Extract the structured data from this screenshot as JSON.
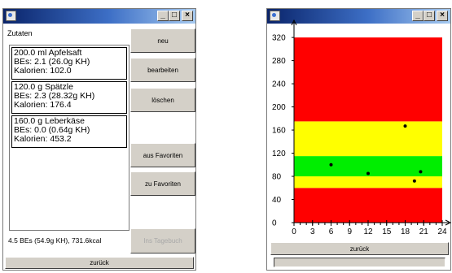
{
  "zutaten_window": {
    "title": "",
    "heading": "Zutaten",
    "items": [
      {
        "line1": "200.0 ml Apfelsaft",
        "line2": "BEs: 2.1  (26.0g KH)",
        "line3": "Kalorien: 102.0"
      },
      {
        "line1": "120.0 g Spätzle",
        "line2": "BEs: 2.3  (28.32g KH)",
        "line3": "Kalorien: 176.4"
      },
      {
        "line1": "160.0 g Leberkäse",
        "line2": "BEs: 0.0  (0.64g KH)",
        "line3": "Kalorien: 453.2"
      }
    ],
    "buttons": {
      "neu": "neu",
      "bearbeiten": "bearbeiten",
      "loeschen": "löschen",
      "aus_favoriten": "aus Favoriten",
      "zu_favoriten": "zu Favoriten",
      "ins_tagebuch": "Ins Tagebuch",
      "zurueck": "zurück"
    },
    "summary": "4.5 BEs (54.9g KH), 731.6kcal"
  },
  "chart_window": {
    "title": "",
    "zurueck": "zurück",
    "chart_data": {
      "type": "scatter",
      "x": [
        6,
        12,
        18,
        19.5,
        20.5
      ],
      "y": [
        100,
        85,
        167,
        72,
        88
      ],
      "xlim": [
        0,
        24
      ],
      "ylim": [
        0,
        330
      ],
      "xticks": [
        0,
        3,
        6,
        9,
        12,
        15,
        18,
        21,
        24
      ],
      "yticks": [
        0,
        40,
        80,
        120,
        160,
        200,
        240,
        280,
        320
      ],
      "bands": [
        {
          "from": 0,
          "to": 60,
          "color": "#ff0000"
        },
        {
          "from": 60,
          "to": 80,
          "color": "#ffff00"
        },
        {
          "from": 80,
          "to": 115,
          "color": "#00ee00"
        },
        {
          "from": 115,
          "to": 175,
          "color": "#ffff00"
        },
        {
          "from": 175,
          "to": 320,
          "color": "#ff0000"
        }
      ],
      "title": "",
      "xlabel": "",
      "ylabel": ""
    }
  }
}
